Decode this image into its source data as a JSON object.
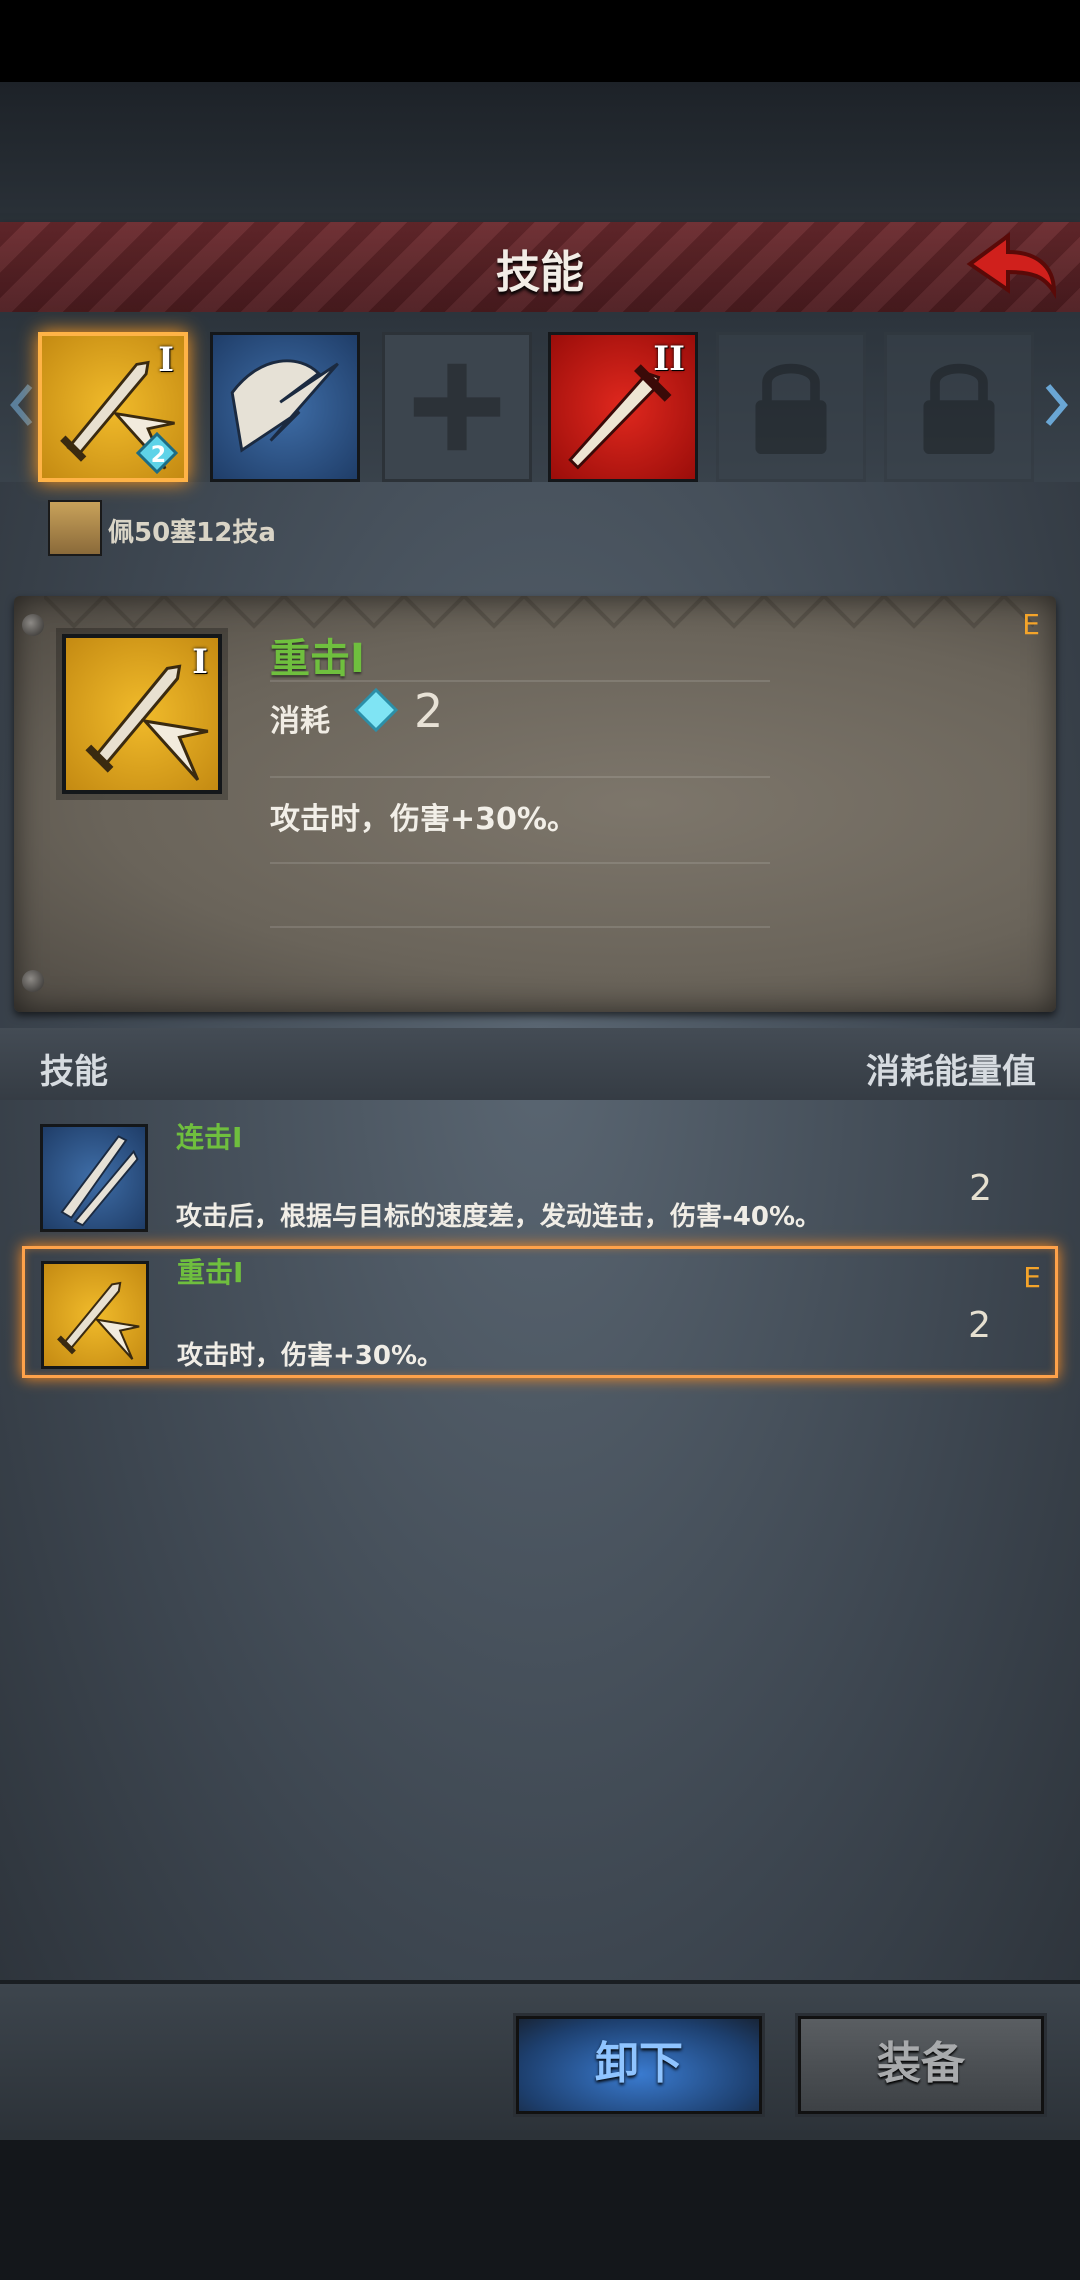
{
  "header": {
    "title": "技能"
  },
  "slots": [
    {
      "tier": "I",
      "badge": "2",
      "state": "selected",
      "style": "gold-sword-arrow"
    },
    {
      "tier": "",
      "badge": "",
      "state": "filled",
      "style": "blue-wings"
    },
    {
      "tier": "",
      "badge": "",
      "state": "empty",
      "style": "cross"
    },
    {
      "tier": "II",
      "badge": "",
      "state": "filled",
      "style": "red-sword"
    },
    {
      "tier": "",
      "badge": "",
      "state": "locked",
      "style": "padlock"
    },
    {
      "tier": "",
      "badge": "",
      "state": "locked",
      "style": "padlock"
    }
  ],
  "hero": {
    "name": "佩50塞12技a"
  },
  "detail": {
    "tier": "I",
    "name": "重击I",
    "cost_label": "消耗",
    "cost_value": "2",
    "description": "攻击时，伤害+30%。",
    "equipped_mark": "E"
  },
  "list": {
    "header_left": "技能",
    "header_right": "消耗能量值",
    "items": [
      {
        "name": "连击I",
        "description": "攻击后，根据与目标的速度差，发动连击，伤害-40%。",
        "cost": "2",
        "equipped_mark": "",
        "selected": false
      },
      {
        "name": "重击I",
        "description": "攻击时，伤害+30%。",
        "cost": "2",
        "equipped_mark": "E",
        "selected": true
      }
    ]
  },
  "buttons": {
    "unequip": "卸下",
    "equip": "装备"
  },
  "colors": {
    "skill_name_green": "#6fbf3e",
    "selection_orange": "#ffa24a",
    "title_bar_red": "#6b2a2e"
  }
}
